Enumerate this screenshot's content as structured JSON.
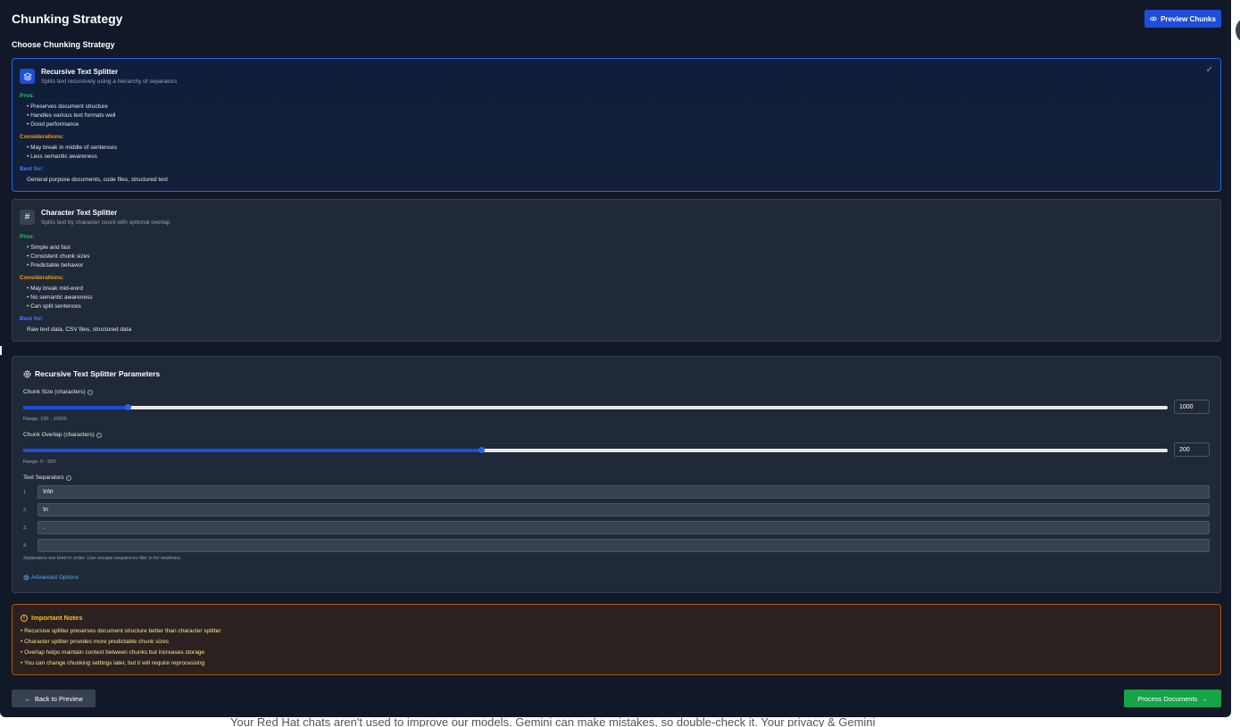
{
  "header": {
    "title": "Chunking Strategy",
    "preview_button": "Preview Chunks",
    "preview_icon": "eye-icon"
  },
  "choose_title": "Choose Chunking Strategy",
  "strategies": [
    {
      "name": "Recursive Text Splitter",
      "description": "Splits text recursively using a hierarchy of separators",
      "icon": "layers-icon",
      "selected": true,
      "pros_label": "Pros:",
      "pros": [
        "• Preserves document structure",
        "• Handles various text formats well",
        "• Good performance"
      ],
      "cons_label": "Considerations:",
      "cons": [
        "• May break in middle of sentences",
        "• Less semantic awareness"
      ],
      "best_label": "Best for:",
      "best_for": "General purpose documents, code files, structured text"
    },
    {
      "name": "Character Text Splitter",
      "description": "Splits text by character count with optional overlap",
      "icon": "hash-icon",
      "selected": false,
      "pros_label": "Pros:",
      "pros": [
        "• Simple and fast",
        "• Consistent chunk sizes",
        "• Predictable behavior"
      ],
      "cons_label": "Considerations:",
      "cons": [
        "• May break mid-word",
        "• No semantic awareness",
        "• Can split sentences"
      ],
      "best_label": "Best for:",
      "best_for": "Raw text data, CSV files, structured data"
    }
  ],
  "params": {
    "title": "Recursive Text Splitter Parameters",
    "chunk_size": {
      "label": "Chunk Size (characters)",
      "value": "1000",
      "range": "Range: 100 - 10000",
      "fill_fraction": 0.0909
    },
    "chunk_overlap": {
      "label": "Chunk Overlap (characters)",
      "value": "200",
      "range": "Range: 0 - 500",
      "fill_fraction": 0.4
    },
    "separators_label": "Text Separators",
    "separators": [
      {
        "num": "1.",
        "value": "\\n\\n"
      },
      {
        "num": "2.",
        "value": "\\n"
      },
      {
        "num": "3.",
        "value": "."
      },
      {
        "num": "4.",
        "value": ""
      }
    ],
    "separators_help": "Separators are tried in order. Use escape sequences like \\n for newlines.",
    "advanced_options": "Advanced Options"
  },
  "notes": {
    "title": "Important Notes",
    "items": [
      "• Recursive splitter preserves document structure better than character splitter",
      "• Character splitter provides more predictable chunk sizes",
      "• Overlap helps maintain context between chunks but increases storage",
      "• You can change chunking settings later, but it will require reprocessing"
    ]
  },
  "footer": {
    "back": "Back to Preview",
    "process": "Process Documents"
  },
  "bottom_caption": {
    "text": "Your Red Hat chats aren't used to improve our models. Gemini can make mistakes, so double-check it.",
    "link": "Your privacy & Gemini"
  },
  "colors": {
    "accent": "#1d4ed8",
    "success": "#16a34a",
    "warning": "#f59e0b",
    "background": "#111827"
  }
}
